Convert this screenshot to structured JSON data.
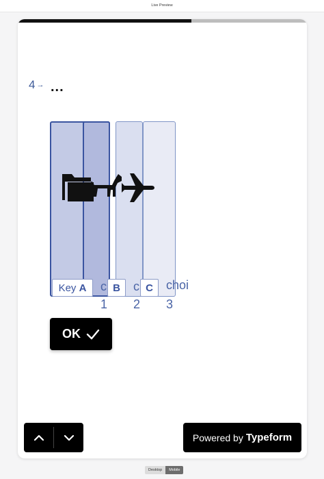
{
  "window": {
    "title": "Live Preview"
  },
  "progress": {
    "fraction": 0.6
  },
  "question": {
    "number": "4",
    "arrow": "→",
    "title": "..."
  },
  "choices": [
    {
      "key": "A",
      "key_prefix": "Key",
      "label_lines": [],
      "icon": "folder-icon"
    },
    {
      "key": "B",
      "label_lines": [
        "c",
        "1"
      ],
      "icon": "dog-icon"
    },
    {
      "key": "C",
      "label_lines": [
        "c",
        "2"
      ],
      "icon": "airplane-icon"
    },
    {
      "key": "",
      "label_lines": [
        "choi",
        "3"
      ],
      "icon": ""
    }
  ],
  "ok_button": {
    "label": "OK"
  },
  "footer": {
    "powered_text": "Powered by",
    "brand": "Typeform"
  },
  "device_toggle": {
    "desktop": "Desktop",
    "mobile": "Mobile",
    "selected": "Mobile"
  },
  "colors": {
    "accent": "#3a54a0",
    "progress": "#111111",
    "button_bg": "#000000"
  }
}
